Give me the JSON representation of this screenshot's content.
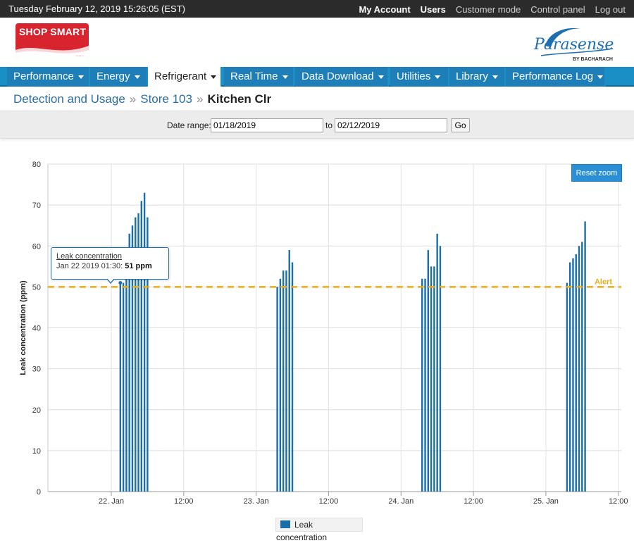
{
  "topbar": {
    "datetime": "Tuesday February 12, 2019 15:26:05 (EST)",
    "links": [
      {
        "label": "My Account",
        "bold": true
      },
      {
        "label": "Users",
        "bold": true
      },
      {
        "label": "Customer mode",
        "bold": false
      },
      {
        "label": "Control panel",
        "bold": false
      },
      {
        "label": "Log out",
        "bold": false
      }
    ]
  },
  "brand": {
    "left_logo": "SHOP SMART",
    "right_logo": "Parasense",
    "right_logo_by": "BY BACHARACH",
    "shop_color": "#d7242f",
    "para_color": "#1d6fb0"
  },
  "nav": {
    "items": [
      {
        "label": "Performance",
        "active": false
      },
      {
        "label": "Energy",
        "active": false
      },
      {
        "label": "Refrigerant",
        "active": true
      },
      {
        "label": "Real Time",
        "active": false
      },
      {
        "label": "Data Download",
        "active": false
      },
      {
        "label": "Utilities",
        "active": false
      },
      {
        "label": "Library",
        "active": false
      },
      {
        "label": "Performance Log",
        "active": false
      }
    ]
  },
  "breadcrumb": {
    "items": [
      "Detection and Usage",
      "Store 103"
    ],
    "current": "Kitchen Clr",
    "separator": "»"
  },
  "daterange": {
    "label": "Date range:",
    "from": "01/18/2019",
    "to_label": "to",
    "to": "02/12/2019",
    "go_label": "Go"
  },
  "chart": {
    "reset_zoom_label": "Reset zoom",
    "tooltip": {
      "series": "Leak concentration",
      "point": "Jan 22 2019 01:30: ",
      "value": "51 ppm"
    },
    "legend_label": "Leak concentration"
  },
  "chart_data": {
    "type": "bar",
    "ylabel": "Leak concentration (ppm)",
    "ylim": [
      0,
      80
    ],
    "yticks": [
      0,
      10,
      20,
      30,
      40,
      50,
      60,
      70,
      80
    ],
    "xticks": [
      "22. Jan",
      "12:00",
      "23. Jan",
      "12:00",
      "24. Jan",
      "12:00",
      "25. Jan",
      "12:00"
    ],
    "x_domain_hours": [
      -10.5,
      84.5
    ],
    "alert": {
      "value": 50,
      "label": "Alert",
      "color": "#e8ac18"
    },
    "bar_color": "#1a6fa8",
    "series": [
      {
        "name": "Leak concentration",
        "points": [
          {
            "t": 1.5,
            "v": 51
          },
          {
            "t": 2.0,
            "v": 51
          },
          {
            "t": 2.5,
            "v": 57
          },
          {
            "t": 3.0,
            "v": 63
          },
          {
            "t": 3.5,
            "v": 65
          },
          {
            "t": 4.0,
            "v": 67
          },
          {
            "t": 4.5,
            "v": 68
          },
          {
            "t": 5.0,
            "v": 71
          },
          {
            "t": 5.5,
            "v": 73
          },
          {
            "t": 6.0,
            "v": 67
          },
          {
            "t": 27.5,
            "v": 50
          },
          {
            "t": 28.0,
            "v": 52
          },
          {
            "t": 28.5,
            "v": 54
          },
          {
            "t": 29.0,
            "v": 54
          },
          {
            "t": 29.5,
            "v": 59
          },
          {
            "t": 30.0,
            "v": 56
          },
          {
            "t": 51.5,
            "v": 52
          },
          {
            "t": 52.0,
            "v": 52
          },
          {
            "t": 52.5,
            "v": 59
          },
          {
            "t": 53.0,
            "v": 55
          },
          {
            "t": 53.5,
            "v": 55
          },
          {
            "t": 54.0,
            "v": 63
          },
          {
            "t": 54.5,
            "v": 60
          },
          {
            "t": 75.5,
            "v": 51
          },
          {
            "t": 76.0,
            "v": 56
          },
          {
            "t": 76.5,
            "v": 57
          },
          {
            "t": 77.0,
            "v": 58
          },
          {
            "t": 77.5,
            "v": 60
          },
          {
            "t": 78.0,
            "v": 61
          },
          {
            "t": 78.5,
            "v": 66
          }
        ]
      }
    ]
  }
}
